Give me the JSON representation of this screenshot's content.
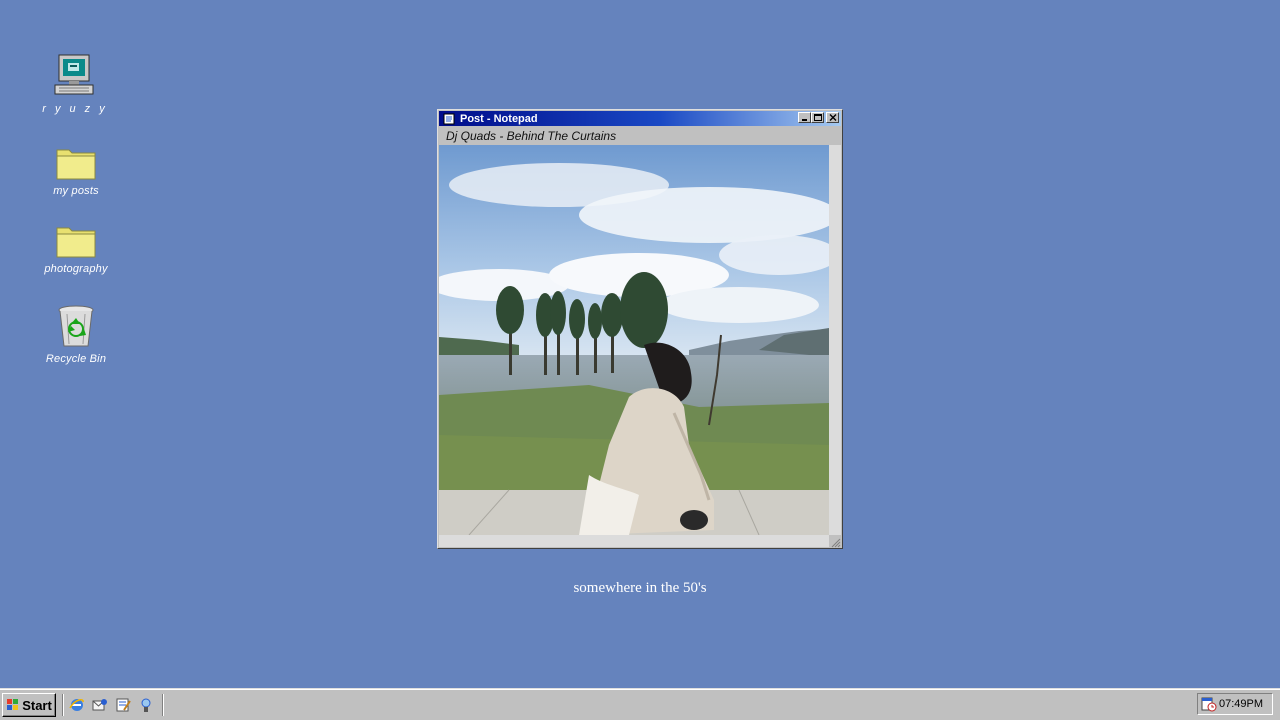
{
  "desktop": {
    "background": "#6583bd",
    "icons": [
      {
        "label": "r y u z y",
        "icon": "my-computer-icon"
      },
      {
        "label": "my posts",
        "icon": "folder-icon"
      },
      {
        "label": "photography",
        "icon": "folder-icon"
      },
      {
        "label": "Recycle Bin",
        "icon": "recycle-bin-icon"
      }
    ]
  },
  "window": {
    "title": "Post - Notepad",
    "subtitle": "Dj Quads - Behind The Curtains",
    "image": "photo of a woman in a beige coat sitting on a concrete ledge beside a lake with trees and cloudy sky"
  },
  "caption": "somewhere in the 50's",
  "taskbar": {
    "start_label": "Start",
    "quick_launch": [
      "internet-explorer-icon",
      "outlook-express-icon",
      "notepad-icon",
      "media-icon"
    ],
    "clock": "07:49PM"
  }
}
